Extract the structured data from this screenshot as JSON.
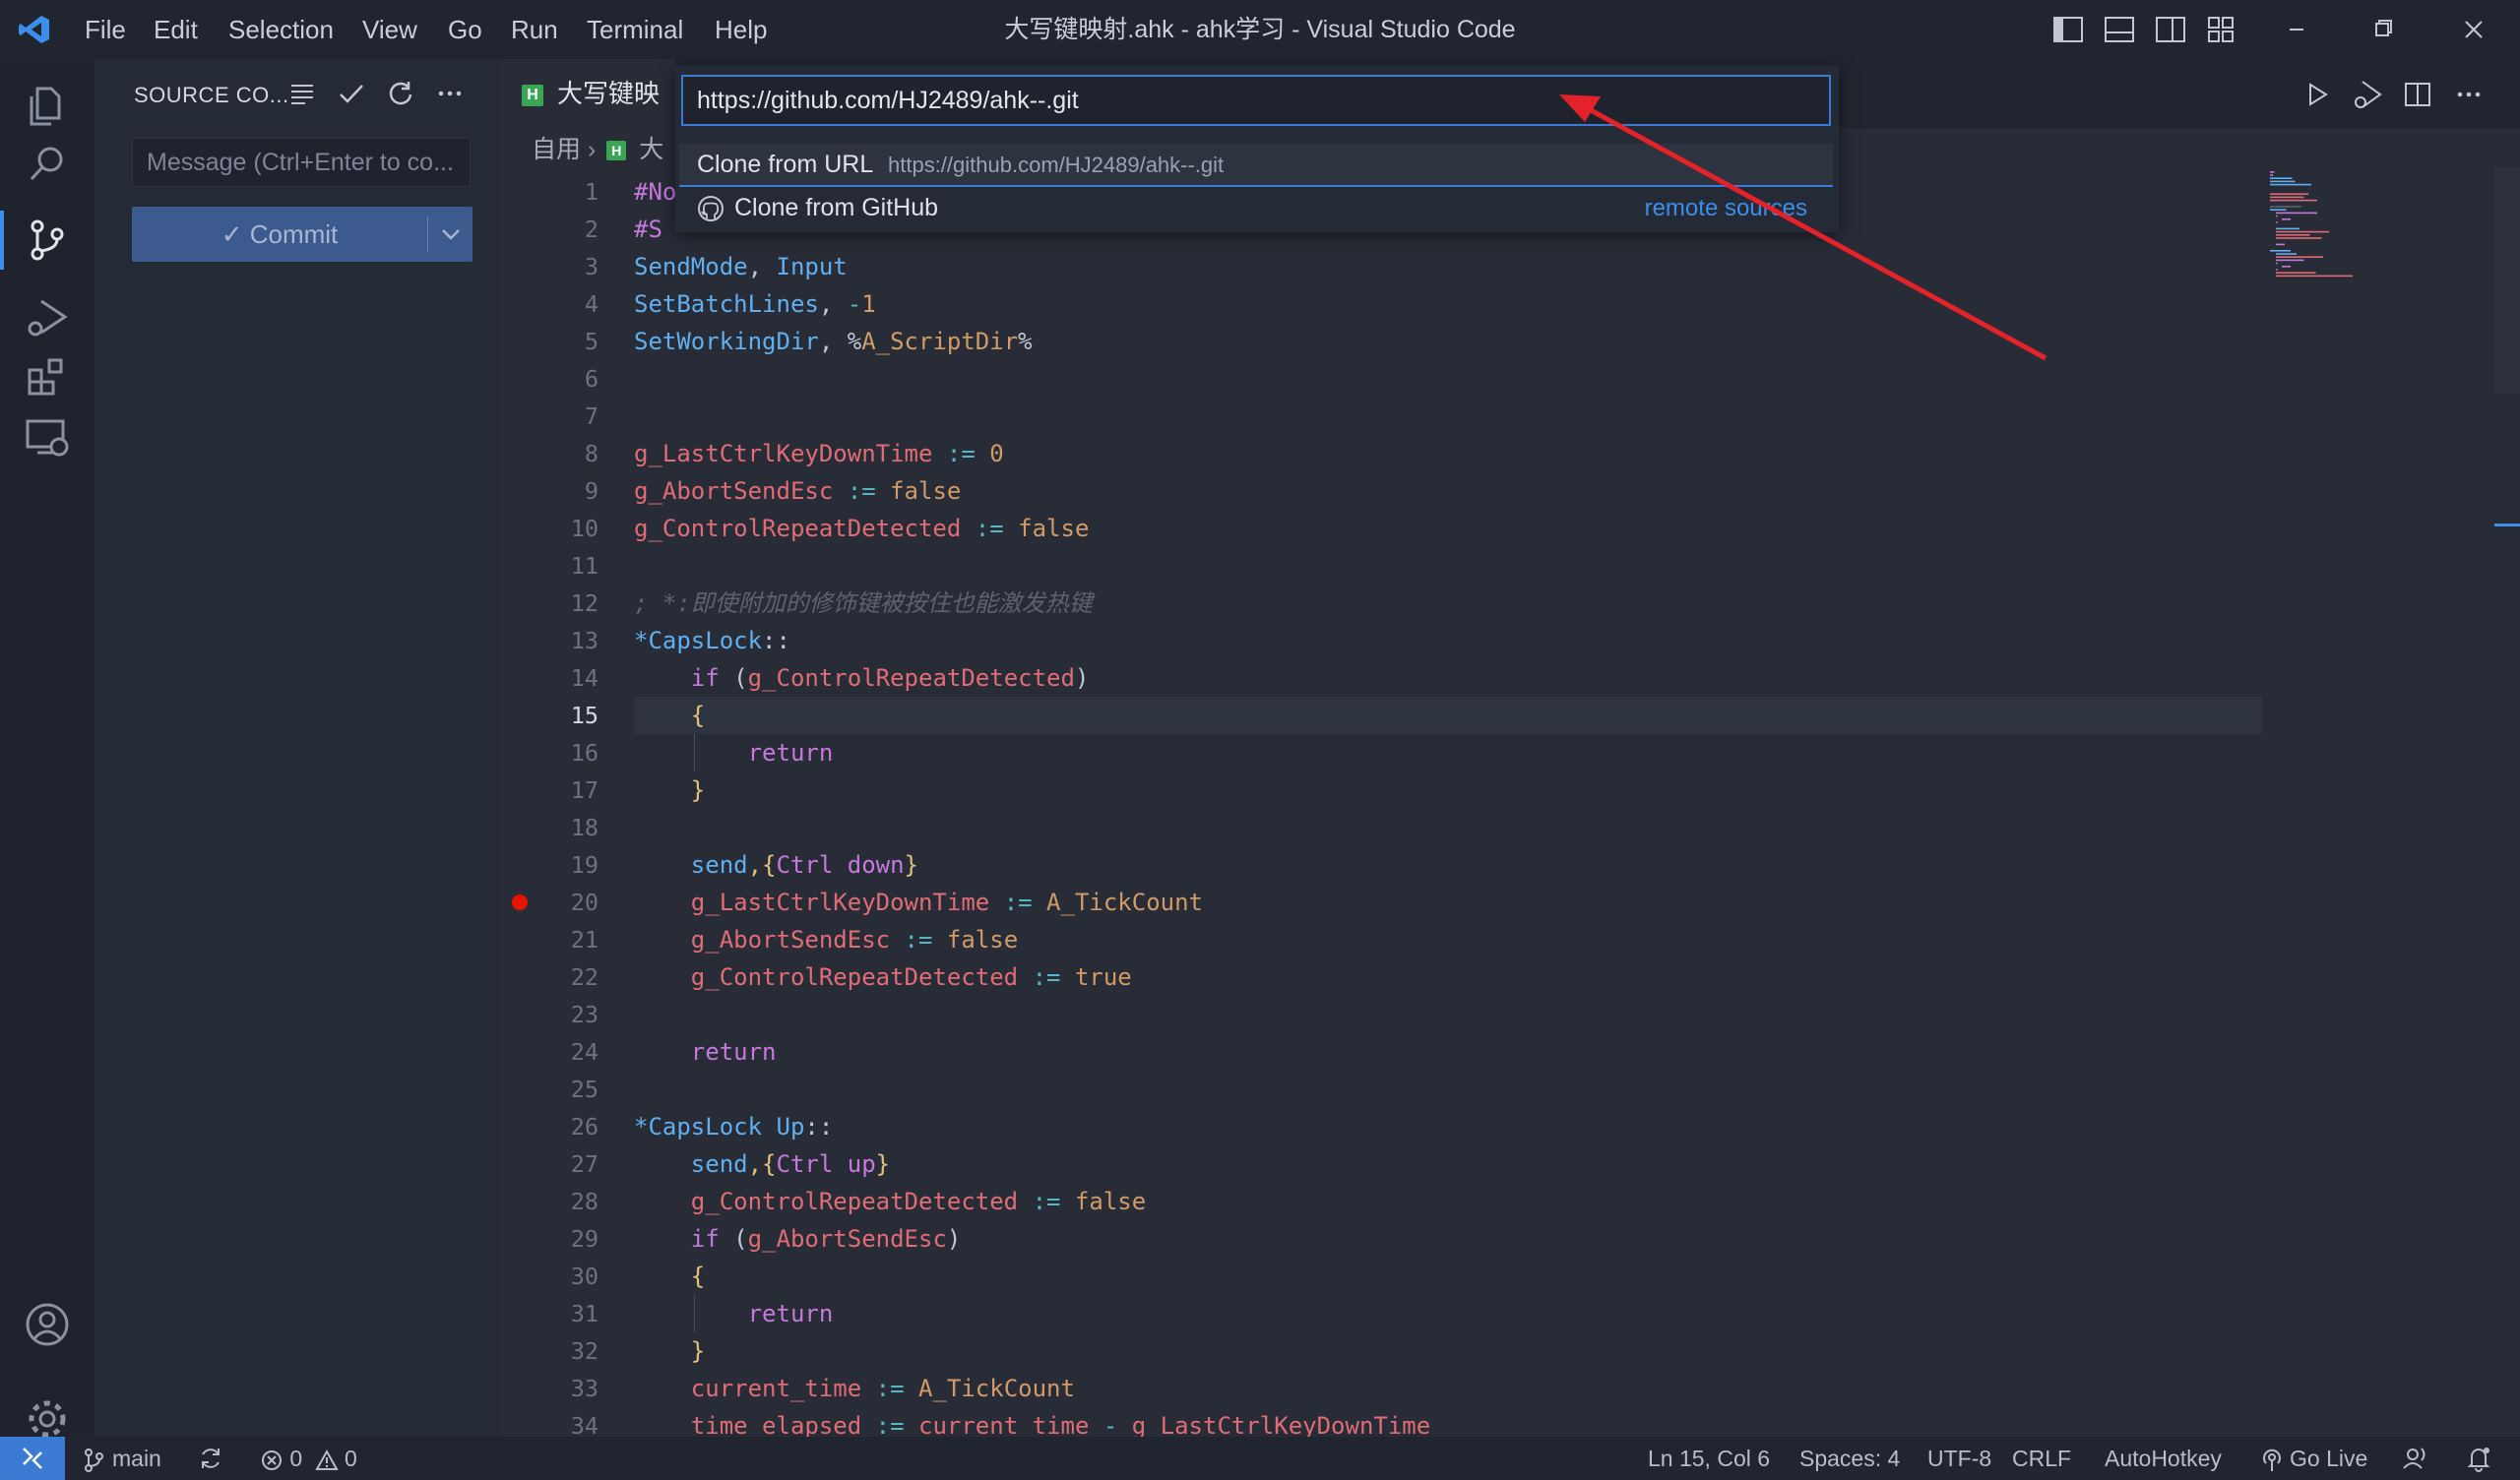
{
  "window": {
    "title": "大写键映射.ahk - ahk学习 - Visual Studio Code",
    "menu": [
      "File",
      "Edit",
      "Selection",
      "View",
      "Go",
      "Run",
      "Terminal",
      "Help"
    ]
  },
  "activity_bar": {
    "icons": [
      "explorer-icon",
      "search-icon",
      "source-control-icon",
      "run-debug-icon",
      "extensions-icon",
      "remote-explorer-icon",
      "account-icon",
      "settings-gear-icon"
    ],
    "active": "source-control-icon"
  },
  "sidebar": {
    "title": "SOURCE CO...",
    "commit_placeholder": "Message (Ctrl+Enter to co...",
    "commit_button": "✓ Commit"
  },
  "editor": {
    "tab_label": "大写键映",
    "breadcrumb_root": "自用",
    "breadcrumb_file": "大",
    "current_line": 15,
    "breakpoint_line": 20,
    "lines": [
      "#No",
      "#S",
      "SendMode, Input",
      "SetBatchLines, -1",
      "SetWorkingDir, %A_ScriptDir%",
      "",
      "",
      "g_LastCtrlKeyDownTime := 0",
      "g_AbortSendEsc := false",
      "g_ControlRepeatDetected := false",
      "",
      "; *:即使附加的修饰键被按住也能激发热键",
      "*CapsLock::",
      "    if (g_ControlRepeatDetected)",
      "    {",
      "        return",
      "    }",
      "",
      "    send,{Ctrl down}",
      "    g_LastCtrlKeyDownTime := A_TickCount",
      "    g_AbortSendEsc := false",
      "    g_ControlRepeatDetected := true",
      "",
      "    return",
      "",
      "*CapsLock Up::",
      "    send,{Ctrl up}",
      "    g_ControlRepeatDetected := false",
      "    if (g_AbortSendEsc)",
      "    {",
      "        return",
      "    }",
      "    current_time := A_TickCount",
      "    time_elapsed := current_time - g_LastCtrlKeyDownTime"
    ]
  },
  "quick_pick": {
    "input_value": "https://github.com/HJ2489/ahk--.git",
    "items": [
      {
        "label": "Clone from URL",
        "description": "https://github.com/HJ2489/ahk--.git"
      },
      {
        "label": "Clone from GitHub",
        "link": "remote sources"
      }
    ]
  },
  "status_bar": {
    "branch": "main",
    "errors": "0",
    "warnings": "0",
    "cursor": "Ln 15, Col 6",
    "spaces": "Spaces: 4",
    "encoding": "UTF-8",
    "eol": "CRLF",
    "language": "AutoHotkey",
    "go_live": "Go Live"
  },
  "colors": {
    "accent": "#3b7bd4",
    "arrow": "#e3222a",
    "breakpoint": "#e51400"
  }
}
